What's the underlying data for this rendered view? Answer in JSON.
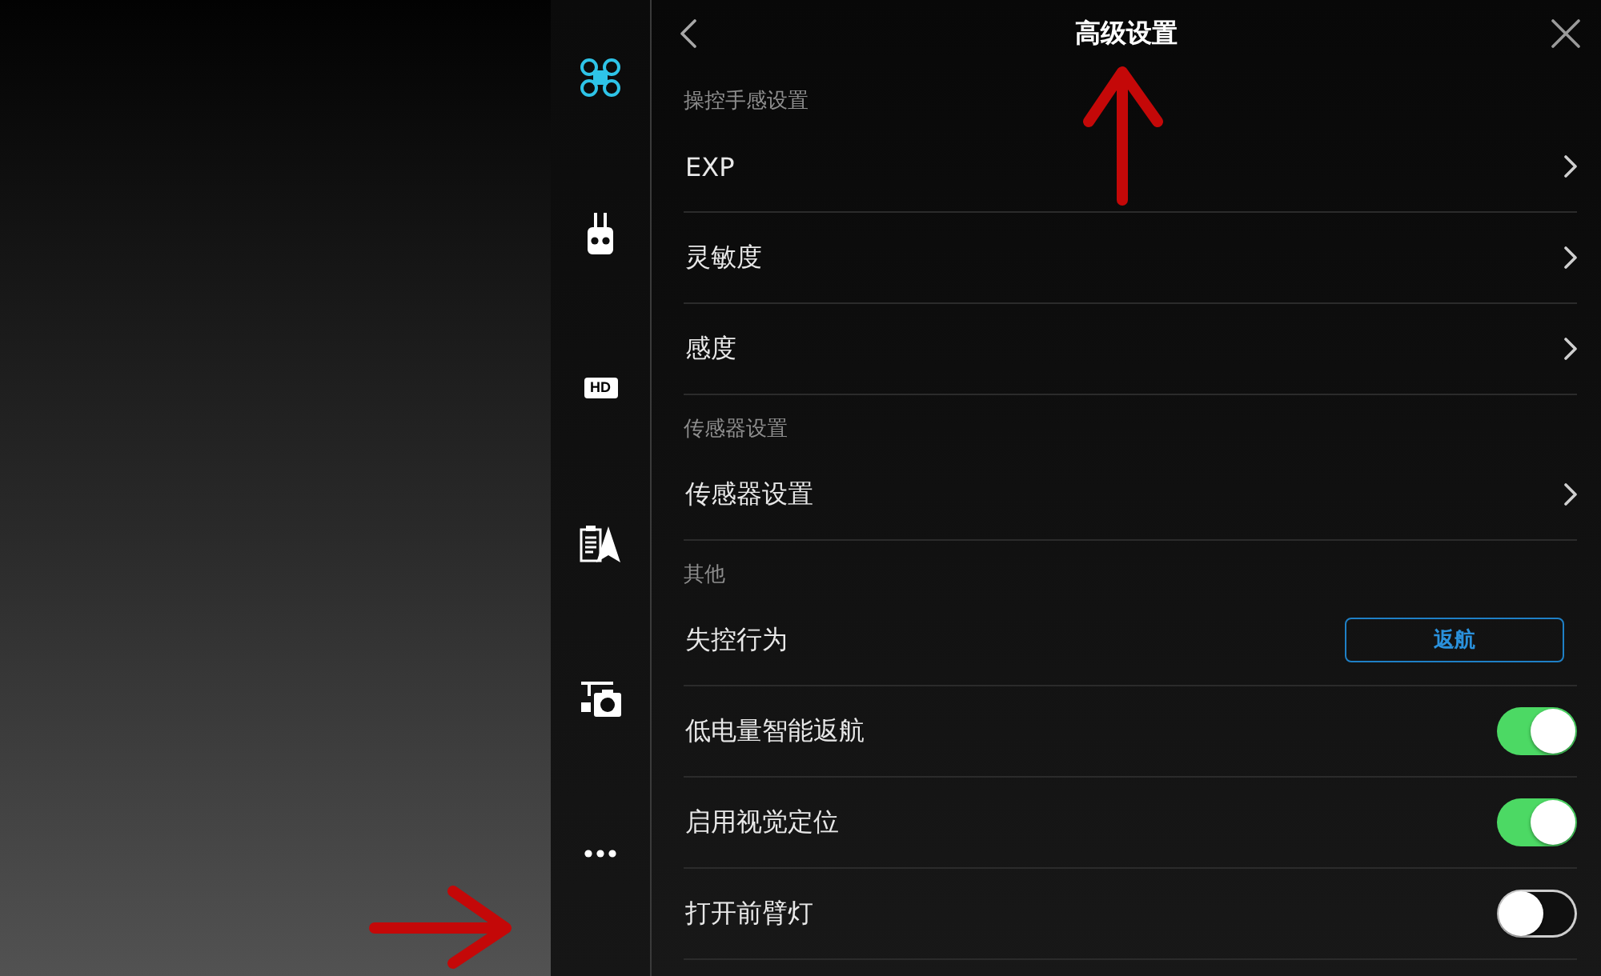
{
  "sidebar": {
    "items": [
      {
        "kind": "aircraft",
        "selected": true
      },
      {
        "kind": "remote",
        "selected": false
      },
      {
        "kind": "hd",
        "label": "HD",
        "selected": false
      },
      {
        "kind": "map",
        "selected": false
      },
      {
        "kind": "gimbal",
        "selected": false
      },
      {
        "kind": "more",
        "selected": false
      }
    ]
  },
  "header": {
    "title": "高级设置"
  },
  "sections": [
    {
      "title": "操控手感设置",
      "rows": [
        {
          "kind": "link",
          "label": "EXP"
        },
        {
          "kind": "link",
          "label": "灵敏度"
        },
        {
          "kind": "link",
          "label": "感度"
        }
      ]
    },
    {
      "title": "传感器设置",
      "rows": [
        {
          "kind": "link",
          "label": "传感器设置"
        }
      ]
    },
    {
      "title": "其他",
      "rows": [
        {
          "kind": "button",
          "label": "失控行为",
          "value": "返航"
        },
        {
          "kind": "toggle",
          "label": "低电量智能返航",
          "on": true
        },
        {
          "kind": "toggle",
          "label": "启用视觉定位",
          "on": true
        },
        {
          "kind": "toggle",
          "label": "打开前臂灯",
          "on": false
        }
      ]
    }
  ]
}
